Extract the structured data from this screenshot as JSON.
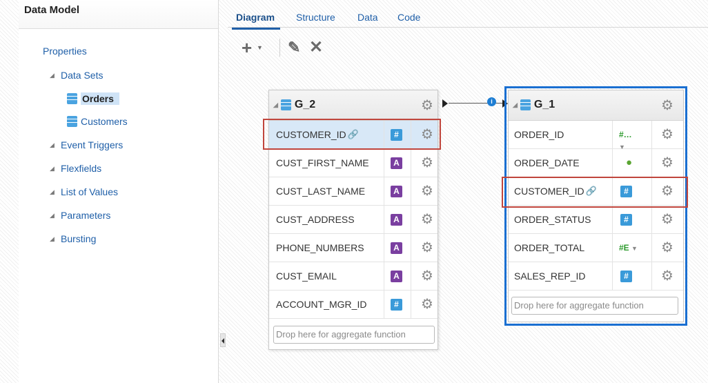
{
  "left_panel": {
    "title": "Data Model",
    "tree": [
      {
        "label": "Properties",
        "level": 0,
        "kind": "link"
      },
      {
        "label": "Data Sets",
        "level": 1,
        "kind": "folder",
        "expanded": true
      },
      {
        "label": "Orders",
        "level": 2,
        "kind": "dataset",
        "selected": true
      },
      {
        "label": "Customers",
        "level": 2,
        "kind": "dataset"
      },
      {
        "label": "Event Triggers",
        "level": 1,
        "kind": "folder",
        "expanded": true
      },
      {
        "label": "Flexfields",
        "level": 1,
        "kind": "folder",
        "expanded": true
      },
      {
        "label": "List of Values",
        "level": 1,
        "kind": "folder",
        "expanded": true
      },
      {
        "label": "Parameters",
        "level": 1,
        "kind": "folder",
        "expanded": true
      },
      {
        "label": "Bursting",
        "level": 1,
        "kind": "folder",
        "expanded": true
      }
    ]
  },
  "tabs": [
    {
      "label": "Diagram",
      "active": true
    },
    {
      "label": "Structure"
    },
    {
      "label": "Data"
    },
    {
      "label": "Code"
    }
  ],
  "toolbar": {
    "add_icon": "plus-icon",
    "edit_icon": "pencil-icon",
    "delete_icon": "x-icon"
  },
  "groups": {
    "g2": {
      "title": "G_2",
      "rows": [
        {
          "name": "CUSTOMER_ID",
          "type": "number",
          "linked": true,
          "selected": true
        },
        {
          "name": "CUST_FIRST_NAME",
          "type": "string"
        },
        {
          "name": "CUST_LAST_NAME",
          "type": "string"
        },
        {
          "name": "CUST_ADDRESS",
          "type": "string"
        },
        {
          "name": "PHONE_NUMBERS",
          "type": "string"
        },
        {
          "name": "CUST_EMAIL",
          "type": "string"
        },
        {
          "name": "ACCOUNT_MGR_ID",
          "type": "number"
        }
      ],
      "drop_text": "Drop here for aggregate function"
    },
    "g1": {
      "title": "G_1",
      "rows": [
        {
          "name": "ORDER_ID",
          "type": "number-sort",
          "icon_text": "#…"
        },
        {
          "name": "ORDER_DATE",
          "type": "date"
        },
        {
          "name": "CUSTOMER_ID",
          "type": "number",
          "linked": true
        },
        {
          "name": "ORDER_STATUS",
          "type": "number"
        },
        {
          "name": "ORDER_TOTAL",
          "type": "number-sort",
          "icon_text": "#E"
        },
        {
          "name": "SALES_REP_ID",
          "type": "number"
        }
      ],
      "drop_text": "Drop here for aggregate function"
    }
  },
  "colors": {
    "accent": "#1f5fa8",
    "selection_box": "#c0453c",
    "group_frame": "#1a6fd1",
    "number_type": "#3a9ad9",
    "string_type": "#7a3fa0"
  }
}
